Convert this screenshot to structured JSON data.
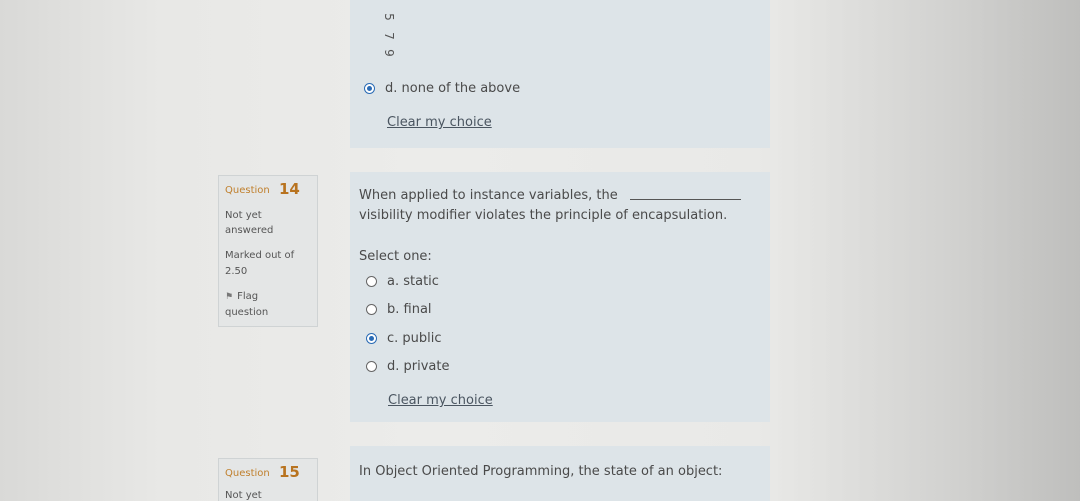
{
  "prev_question": {
    "visible_numbers": [
      "5",
      "7",
      "9"
    ],
    "selected_option": "d. none of the above",
    "clear_link": "Clear my choice"
  },
  "q14": {
    "label": "Question",
    "number": "14",
    "status_line1": "Not yet",
    "status_line2": "answered",
    "marked_line1": "Marked out of",
    "marked_line2": "2.50",
    "flag_line1": "Flag",
    "flag_line2": "question",
    "text_line1": "When applied to instance variables, the",
    "text_line2": "visibility modifier violates the principle of encapsulation.",
    "select_one": "Select one:",
    "options": [
      {
        "label": "a. static",
        "checked": false
      },
      {
        "label": "b. final",
        "checked": false
      },
      {
        "label": "c. public",
        "checked": true
      },
      {
        "label": "d. private",
        "checked": false
      }
    ],
    "clear_link": "Clear my choice"
  },
  "q15": {
    "label": "Question",
    "number": "15",
    "status_line1": "Not yet",
    "text": "In Object Oriented Programming, the state of an object:"
  },
  "colors": {
    "panel_bg": "#dde4e8",
    "question_number": "#b8731f",
    "radio_checked": "#2a6bb5"
  }
}
